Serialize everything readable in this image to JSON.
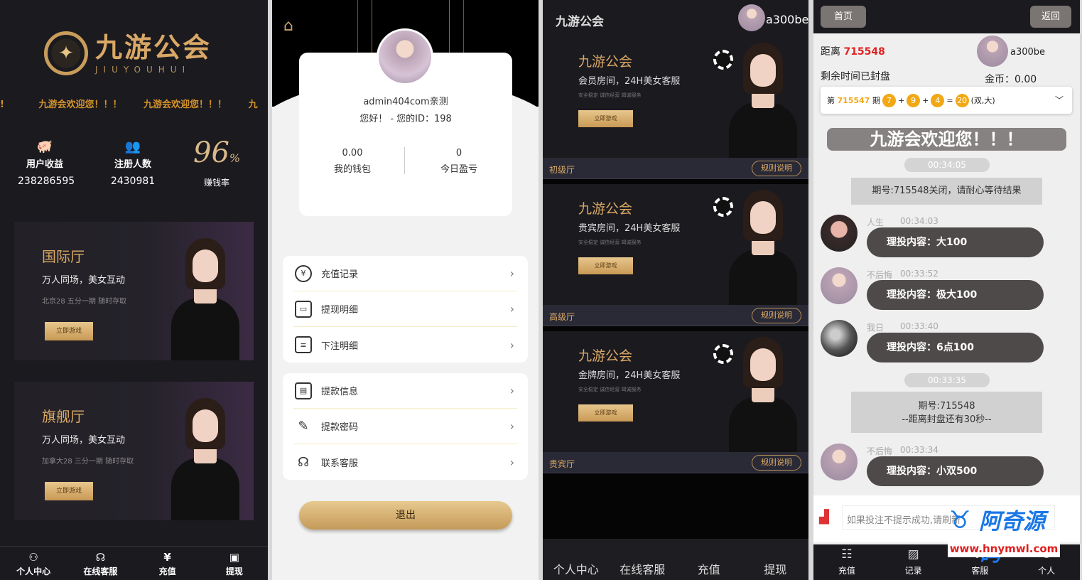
{
  "colors": {
    "gold": "#d9a866",
    "dark": "#1b1a1f",
    "red": "#e02424",
    "ball": "#f2a814",
    "watermark_blue": "#1a77e6"
  },
  "panel1": {
    "logo_cn": "九游公会",
    "logo_en": "JIUYOUHUI",
    "marquee": [
      "!",
      "九游会欢迎您！！！",
      "九游会欢迎您！！！",
      "九"
    ],
    "stats": [
      {
        "icon": "piggy-bank-icon",
        "label": "用户收益",
        "value": "238286595"
      },
      {
        "icon": "users-icon",
        "label": "注册人数",
        "value": "2430981"
      }
    ],
    "rate": {
      "value": "96",
      "unit": "%",
      "label": "赚钱率"
    },
    "halls": [
      {
        "title": "国际厅",
        "subtitle": "万人同场，美女互动",
        "note": "北京28   五分一期   随时存取",
        "button": "立即游戏"
      },
      {
        "title": "旗舰厅",
        "subtitle": "万人同场，美女互动",
        "note": "加拿大28   三分一期   随时存取",
        "button": "立即游戏"
      }
    ],
    "tabs": [
      {
        "icon": "user-icon",
        "label": "个人中心"
      },
      {
        "icon": "headset-icon",
        "label": "在线客服"
      },
      {
        "icon": "yen-icon",
        "label": "充值"
      },
      {
        "icon": "wallet-icon",
        "label": "提现"
      }
    ]
  },
  "panel2": {
    "home_icon": "home-icon",
    "username": "admin404com亲测",
    "greeting": "您好！ - 您的ID：198",
    "wallet": {
      "value": "0.00",
      "label": "我的钱包"
    },
    "today": {
      "value": "0",
      "label": "今日盈亏"
    },
    "menu1": [
      {
        "icon": "yen-circle-icon",
        "label": "充值记录"
      },
      {
        "icon": "wallet-icon",
        "label": "提现明细"
      },
      {
        "icon": "receipt-icon",
        "label": "下注明细"
      }
    ],
    "menu2": [
      {
        "icon": "message-icon",
        "label": "提款信息"
      },
      {
        "icon": "pencil-ruler-icon",
        "label": "提款密码"
      },
      {
        "icon": "headset-icon",
        "label": "联系客服"
      }
    ],
    "logout": "退出"
  },
  "panel3": {
    "brand": "九游公会",
    "username": "a300be",
    "rooms": [
      {
        "title": "九游公会",
        "subtitle": "会员房间，24H美女客服",
        "note": "安全稳定   诚信经营   竭诚服务",
        "button": "立即游戏",
        "hall": "初级厅",
        "rules": "规则说明"
      },
      {
        "title": "九游公会",
        "subtitle": "贵宾房间，24H美女客服",
        "note": "安全稳定   诚信经营   竭诚服务",
        "button": "立即游戏",
        "hall": "高级厅",
        "rules": "规则说明"
      },
      {
        "title": "九游公会",
        "subtitle": "金牌房间，24H美女客服",
        "note": "安全稳定   诚信经营   竭诚服务",
        "button": "立即游戏",
        "hall": "贵宾厅",
        "rules": "规则说明"
      }
    ],
    "tabs": [
      "个人中心",
      "在线客服",
      "充值",
      "提现"
    ]
  },
  "panel4": {
    "home": "首页",
    "back": "返回",
    "distance_label": "距离",
    "distance_value": "715548",
    "remaining": "剩余时间已封盘",
    "username": "a300be",
    "coins": "金币：0.00",
    "result": {
      "prefix": "第",
      "period": "715547",
      "mid": "期",
      "balls": [
        "7",
        "9",
        "4",
        "20"
      ],
      "ops": [
        "+",
        "+",
        "="
      ],
      "suffix": "(双,大)"
    },
    "welcome": "九游会欢迎您！！！",
    "times": [
      "00:34:05",
      "00:33:35"
    ],
    "sys1": "期号:715548关闭，请耐心等待结果",
    "sys2_line1": "期号:715548",
    "sys2_line2": "--距离封盘还有30秒--",
    "messages": [
      {
        "name": "人生",
        "time": "00:34:03",
        "text": "理投内容：大100"
      },
      {
        "name": "不后悔",
        "time": "00:33:52",
        "text": "理投内容：极大100"
      },
      {
        "name": "我日",
        "time": "00:33:40",
        "text": "理投内容：6点100"
      },
      {
        "name": "不后悔",
        "time": "00:33:34",
        "text": "理投内容：小双500"
      }
    ],
    "input_placeholder": "如果投注不提示成功,请刷新",
    "tabs": [
      {
        "icon": "list-icon",
        "label": "充值"
      },
      {
        "icon": "chart-icon",
        "label": "记录"
      },
      {
        "icon": "headset-icon",
        "label": "客服"
      },
      {
        "icon": "user-icon",
        "label": "个人"
      }
    ]
  },
  "watermark": {
    "text": "阿奇源码",
    "url": "www.hnymwl.com"
  }
}
